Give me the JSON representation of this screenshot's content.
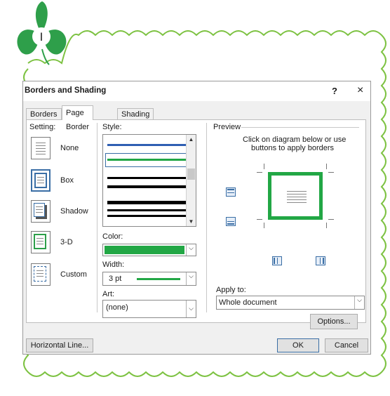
{
  "frame": {
    "marker_letter": "I",
    "border_color": "#7dc242",
    "leaf_color": "#2e9f4a"
  },
  "dialog": {
    "title": "Borders and Shading",
    "help_label": "?",
    "close_label": "×",
    "tabs": [
      {
        "label": "Borders"
      },
      {
        "label": "Page Border"
      },
      {
        "label": "Shading"
      }
    ],
    "active_tab": "Page Border",
    "setting": {
      "heading": "Setting:",
      "options": [
        {
          "label": "None"
        },
        {
          "label": "Box"
        },
        {
          "label": "Shadow"
        },
        {
          "label": "3-D"
        },
        {
          "label": "Custom"
        }
      ],
      "selected": "Box"
    },
    "style": {
      "heading": "Style:"
    },
    "color": {
      "heading": "Color:",
      "value_color": "#22a745"
    },
    "width": {
      "heading": "Width:",
      "value": "3 pt"
    },
    "art": {
      "heading": "Art:",
      "value": "(none)"
    },
    "preview": {
      "heading": "Preview",
      "instruction_line1": "Click on diagram below or use",
      "instruction_line2": "buttons to apply borders",
      "border_color": "#22a745"
    },
    "apply_to": {
      "heading": "Apply to:",
      "value": "Whole document"
    },
    "buttons": {
      "options": "Options...",
      "horizontal_line": "Horizontal Line...",
      "ok": "OK",
      "cancel": "Cancel"
    }
  }
}
